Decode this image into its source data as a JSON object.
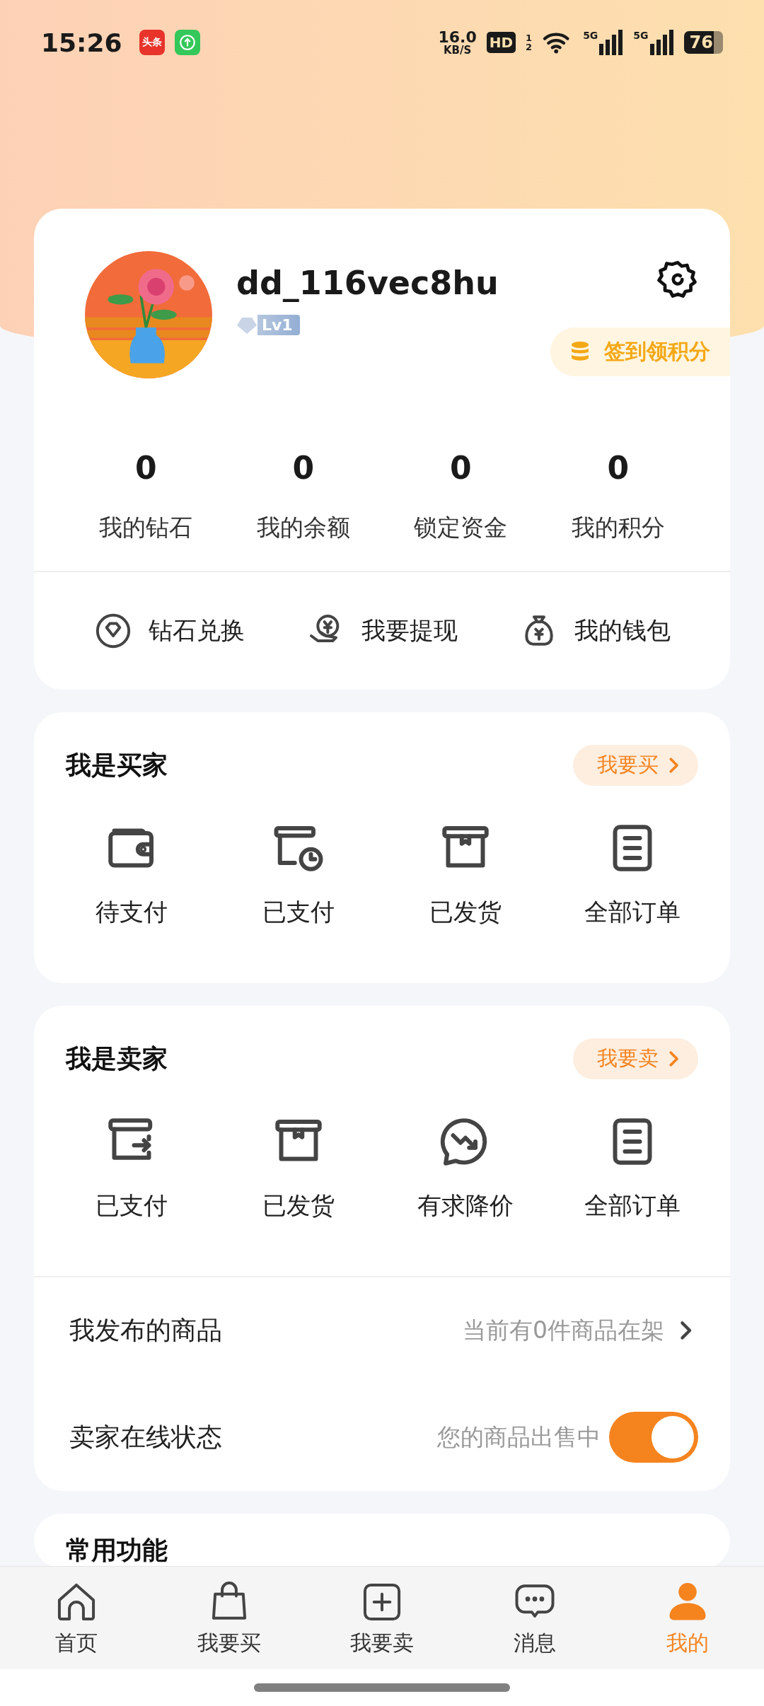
{
  "status_bar": {
    "time": "15:26",
    "apps": [
      {
        "kind": "news",
        "label": "头条"
      },
      {
        "kind": "upload"
      }
    ],
    "net_speed": "16.0",
    "net_unit": "KB/S",
    "hd": "HD",
    "sim_slots": [
      "1",
      "2"
    ],
    "signals": [
      "5G",
      "5G"
    ],
    "battery": "76"
  },
  "profile": {
    "username": "dd_116vec8hu",
    "level": "Lv1",
    "checkin": "签到领积分"
  },
  "stats": [
    {
      "value": "0",
      "label": "我的钻石"
    },
    {
      "value": "0",
      "label": "我的余额"
    },
    {
      "value": "0",
      "label": "锁定资金"
    },
    {
      "value": "0",
      "label": "我的积分"
    }
  ],
  "wallet_actions": [
    {
      "kind": "diamond",
      "label": "钻石兑换"
    },
    {
      "kind": "withdraw",
      "label": "我要提现"
    },
    {
      "kind": "moneybag",
      "label": "我的钱包"
    }
  ],
  "buyer": {
    "title": "我是买家",
    "action": "我要买",
    "orders": [
      {
        "kind": "wallet",
        "label": "待支付"
      },
      {
        "kind": "box_clock",
        "label": "已支付"
      },
      {
        "kind": "box",
        "label": "已发货"
      },
      {
        "kind": "clipboard",
        "label": "全部订单"
      }
    ]
  },
  "seller": {
    "title": "我是卖家",
    "action": "我要卖",
    "orders": [
      {
        "kind": "box_arrow",
        "label": "已支付"
      },
      {
        "kind": "box",
        "label": "已发货"
      },
      {
        "kind": "chat_trend",
        "label": "有求降价"
      },
      {
        "kind": "clipboard",
        "label": "全部订单"
      }
    ],
    "rows": [
      {
        "kind": "link",
        "label": "我发布的商品",
        "value": "当前有0件商品在架"
      },
      {
        "kind": "toggle",
        "label": "卖家在线状态",
        "value": "您的商品出售中",
        "on": true
      }
    ]
  },
  "common": {
    "title": "常用功能"
  },
  "tab_bar": [
    {
      "kind": "home",
      "label": "首页",
      "selected": false
    },
    {
      "kind": "bag",
      "label": "我要买",
      "selected": false
    },
    {
      "kind": "plus",
      "label": "我要卖",
      "selected": false
    },
    {
      "kind": "chat",
      "label": "消息",
      "selected": false
    },
    {
      "kind": "person",
      "label": "我的",
      "selected": true
    }
  ]
}
